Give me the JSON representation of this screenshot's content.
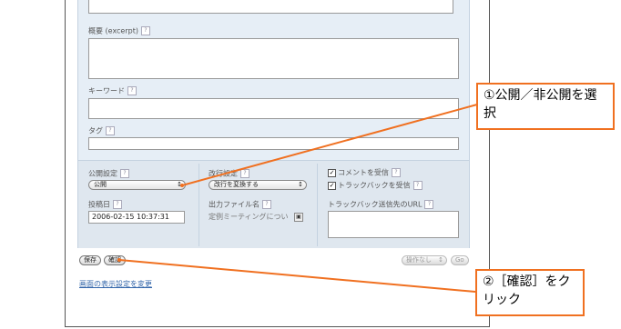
{
  "form": {
    "excerpt_label": "概要 (excerpt)",
    "keyword_label": "キーワード",
    "tag_label": "タグ",
    "help_icon": "?"
  },
  "options": {
    "status_label": "公開設定",
    "status_value": "公開",
    "linebreak_label": "改行設定",
    "linebreak_value": "改行を変換する",
    "comment_label": "コメントを受信",
    "trackback_label": "トラックバックを受信",
    "trackback_url_label": "トラックバック送信先のURL",
    "date_label": "投稿日",
    "date_value": "2006-02-15 10:37:31",
    "filename_label": "出力ファイル名",
    "filename_value": "定例ミーティングについ"
  },
  "actions": {
    "save_label": "保存",
    "preview_label": "確認",
    "bulk_select_value": "操作なし",
    "go_label": "Go",
    "display_settings_link": "画面の表示設定を変更"
  },
  "callouts": {
    "first": "①公開／非公開を選択",
    "second": "②［確認］をクリック"
  },
  "colors": {
    "accent": "#f07020",
    "panel": "#e6eef6"
  }
}
